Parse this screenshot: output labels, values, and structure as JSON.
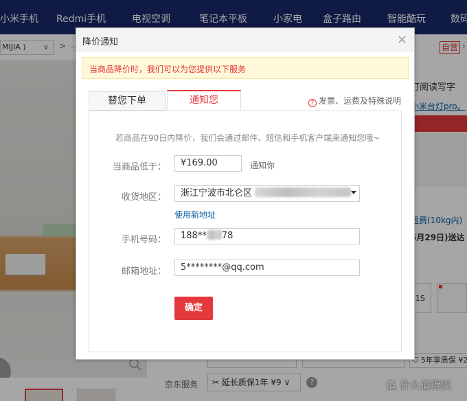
{
  "topnav": {
    "items": [
      "小米手机",
      "Redmi手机",
      "电视空调",
      "笔记本平板",
      "小家电",
      "盒子路由",
      "智能酷玩",
      "数码"
    ]
  },
  "breadcrumb": {
    "selector": "MIJIA )",
    "chevron": "∨",
    "sep": ">",
    "sep2": "ᅿ"
  },
  "badge": "自营",
  "right": {
    "title": "灯阅读写字",
    "link": "小米台灯pro。",
    "fee": "运费(10kg内)",
    "date": "5月29日)送达",
    "box1": "1S",
    "warranty": "5年享质保",
    "warranty_suffix": "¥2"
  },
  "bottom": {
    "service_label": "京东服务",
    "service_value": "延长质保1年 ¥9",
    "service_chevron": "∨",
    "watermark": "值 什么值得买"
  },
  "modal": {
    "title": "降价通知",
    "close": "×",
    "notice": "当商品降价时，我们可以为您提供以下服务",
    "tabs": [
      "替您下单",
      "通知您"
    ],
    "help": "发票、运费及特殊说明",
    "help_icon": "?",
    "intro": "若商品在90日内降价，我们会通过邮件、短信和手机客户端来通知您哦~",
    "price_label": "当商品低于：",
    "price_value": "¥169.00",
    "price_unit": "通知你",
    "region_label": "收货地区：",
    "region_value": "浙江宁波市北仑区",
    "new_address": "使用新地址",
    "phone_label": "手机号码：",
    "phone_prefix": "188**",
    "phone_suffix": "78",
    "email_label": "邮箱地址：",
    "email_value": "5********@qq.com",
    "confirm": "确定"
  }
}
